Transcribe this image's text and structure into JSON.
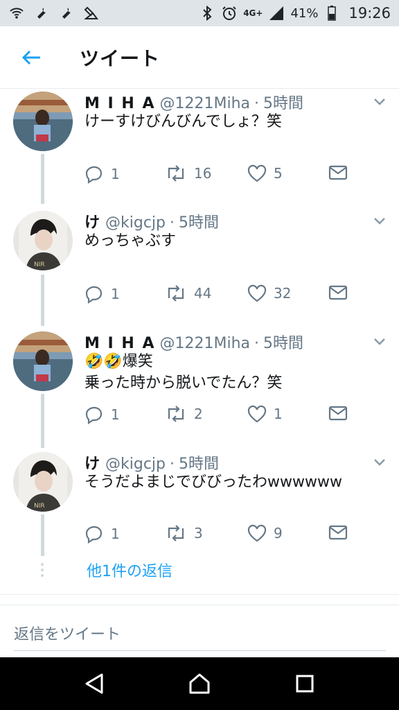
{
  "status_bar": {
    "network": "4G+",
    "battery": "41%",
    "time": "19:26",
    "icons": [
      "wifi-on-icon",
      "wrench-icon",
      "wrench-icon",
      "cast-icon",
      "bluetooth-icon",
      "alarm-icon",
      "signal-icon",
      "battery-icon"
    ]
  },
  "header": {
    "title": "ツイート",
    "back_icon": "back-arrow-icon",
    "accent": "#1da1f2"
  },
  "tweets": [
    {
      "name": "M I H A",
      "handle": "@1221Miha",
      "sep": "·",
      "time": "5時間",
      "lines": [
        "けーすけびんびんでしょ？笑"
      ],
      "replies": "1",
      "retweets": "16",
      "likes": "5"
    },
    {
      "name": "け",
      "handle": "@kigcjp",
      "sep": "·",
      "time": "5時間",
      "lines": [
        "めっちゃぶす"
      ],
      "replies": "1",
      "retweets": "44",
      "likes": "32"
    },
    {
      "name": "M I H A",
      "handle": "@1221Miha",
      "sep": "·",
      "time": "5時間",
      "lines": [
        "🤣🤣爆笑",
        "乗った時から脱いでたん？笑"
      ],
      "replies": "1",
      "retweets": "2",
      "likes": "1"
    },
    {
      "name": "け",
      "handle": "@kigcjp",
      "sep": "·",
      "time": "5時間",
      "lines": [
        "そうだよまじでびびったわwwwwww"
      ],
      "replies": "1",
      "retweets": "3",
      "likes": "9"
    }
  ],
  "more_replies": "他1件の返信",
  "reply_placeholder": "返信をツイート",
  "nav": [
    "back-triangle-icon",
    "home-circle-icon",
    "recents-square-icon"
  ]
}
